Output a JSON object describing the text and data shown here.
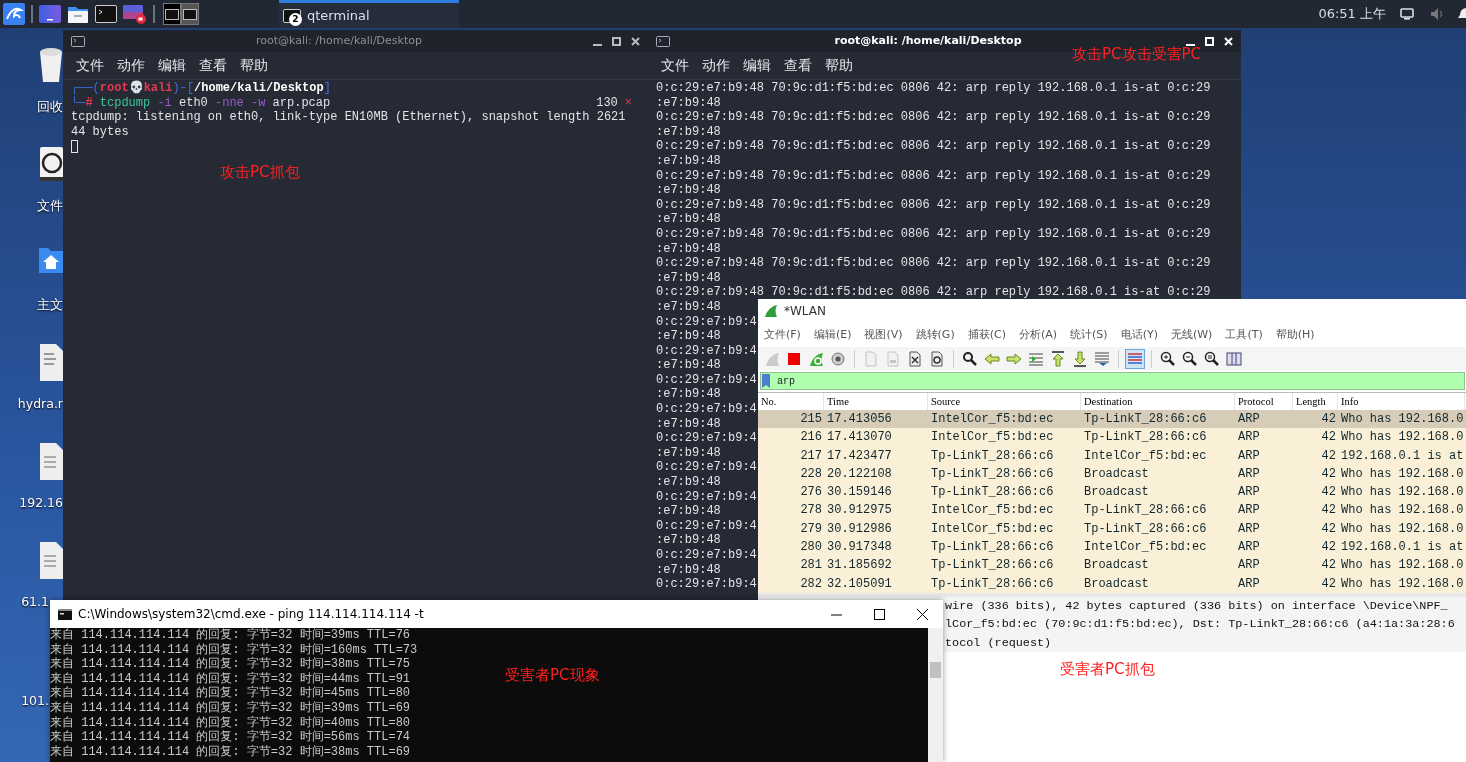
{
  "taskbar": {
    "workspaces": [
      {
        "selected": true
      },
      {
        "selected": false
      }
    ],
    "task": {
      "label": "qterminal",
      "badge": "2",
      "selected": true
    },
    "clock": "06:51 上午"
  },
  "desktop_icons": [
    {
      "label": "回收",
      "kind": "trash"
    },
    {
      "label": "文件",
      "kind": "drive"
    },
    {
      "label": "主文",
      "kind": "home"
    },
    {
      "label": "hydra.r",
      "kind": "binary"
    },
    {
      "label": "192.16",
      "kind": "locked"
    },
    {
      "label": "61.1",
      "kind": "locked"
    },
    {
      "label": "101.",
      "kind": "none"
    }
  ],
  "terminals": [
    {
      "title": "root@kali: /home/kali/Desktop",
      "active": false,
      "menu": [
        "文件",
        "动作",
        "编辑",
        "查看",
        "帮助"
      ],
      "prompt_lines": [
        [
          {
            "text": "┌──(",
            "kind": "frame"
          },
          {
            "text": "root",
            "kind": "user"
          },
          {
            "text": "💀",
            "kind": "symbol"
          },
          {
            "text": "kali",
            "kind": "user"
          },
          {
            "text": ")-[",
            "kind": "frame"
          },
          {
            "text": "/home/kali/Desktop",
            "kind": "path"
          },
          {
            "text": "]",
            "kind": "frame"
          }
        ],
        [
          {
            "text": "└─",
            "kind": "frame"
          },
          {
            "text": "#",
            "kind": "hash"
          },
          {
            "text": "tcpdump",
            "kind": "command"
          },
          {
            "text": "-i",
            "kind": "option"
          },
          {
            "text": "eth0",
            "kind": "argument"
          },
          {
            "text": "-nne",
            "kind": "option"
          },
          {
            "text": "-w",
            "kind": "option"
          },
          {
            "text": "arp.pcap",
            "kind": "argument"
          }
        ]
      ],
      "exit_status": {
        "code": "130",
        "mark": "×"
      },
      "lines": [
        "tcpdump: listening on eth0, link-type EN10MB (Ethernet), snapshot length 2621",
        "44 bytes"
      ],
      "cursor": true
    },
    {
      "title": "root@kali: /home/kali/Desktop",
      "active": true,
      "menu": [
        "文件",
        "动作",
        "编辑",
        "查看",
        "帮助"
      ],
      "lines": [
        "0:c:29:e7:b9:48 70:9c:d1:f5:bd:ec 0806 42: arp reply 192.168.0.1 is-at 0:c:29",
        ":e7:b9:48",
        "0:c:29:e7:b9:48 70:9c:d1:f5:bd:ec 0806 42: arp reply 192.168.0.1 is-at 0:c:29",
        ":e7:b9:48",
        "0:c:29:e7:b9:48 70:9c:d1:f5:bd:ec 0806 42: arp reply 192.168.0.1 is-at 0:c:29",
        ":e7:b9:48",
        "0:c:29:e7:b9:48 70:9c:d1:f5:bd:ec 0806 42: arp reply 192.168.0.1 is-at 0:c:29",
        ":e7:b9:48",
        "0:c:29:e7:b9:48 70:9c:d1:f5:bd:ec 0806 42: arp reply 192.168.0.1 is-at 0:c:29",
        ":e7:b9:48",
        "0:c:29:e7:b9:48 70:9c:d1:f5:bd:ec 0806 42: arp reply 192.168.0.1 is-at 0:c:29",
        ":e7:b9:48",
        "0:c:29:e7:b9:48 70:9c:d1:f5:bd:ec 0806 42: arp reply 192.168.0.1 is-at 0:c:29",
        ":e7:b9:48",
        "0:c:29:e7:b9:48 70:9c:d1:f5:bd:ec 0806 42: arp reply 192.168.0.1 is-at 0:c:29",
        ":e7:b9:48",
        "0:c:29:e7:b9:4",
        ":e7:b9:48",
        "0:c:29:e7:b9:4",
        ":e7:b9:48",
        "0:c:29:e7:b9:4",
        ":e7:b9:48",
        "0:c:29:e7:b9:4",
        ":e7:b9:48",
        "0:c:29:e7:b9:4",
        ":e7:b9:48",
        "0:c:29:e7:b9:4",
        ":e7:b9:48",
        "0:c:29:e7:b9:4",
        ":e7:b9:48",
        "0:c:29:e7:b9:4",
        ":e7:b9:48",
        "0:c:29:e7:b9:4",
        ":e7:b9:48",
        "0:c:29:e7:b9:4"
      ]
    }
  ],
  "wireshark": {
    "title": "*WLAN",
    "menu": [
      "文件(F)",
      "编辑(E)",
      "视图(V)",
      "跳转(G)",
      "捕获(C)",
      "分析(A)",
      "统计(S)",
      "电话(Y)",
      "无线(W)",
      "工具(T)",
      "帮助(H)"
    ],
    "toolbar": [
      [
        {
          "kind": "fin",
          "disabled": true,
          "pressed": false
        },
        {
          "kind": "stop",
          "disabled": false,
          "pressed": false
        },
        {
          "kind": "restart",
          "disabled": false,
          "pressed": false
        },
        {
          "kind": "options",
          "disabled": false,
          "pressed": false
        }
      ],
      [
        {
          "kind": "open",
          "disabled": true,
          "pressed": false
        },
        {
          "kind": "save",
          "disabled": true,
          "pressed": false
        },
        {
          "kind": "close",
          "disabled": false,
          "pressed": false
        },
        {
          "kind": "reload",
          "disabled": false,
          "pressed": false
        }
      ],
      [
        {
          "kind": "find",
          "disabled": false,
          "pressed": false
        },
        {
          "kind": "back",
          "disabled": false,
          "pressed": false
        },
        {
          "kind": "forward",
          "disabled": false,
          "pressed": false
        },
        {
          "kind": "goto",
          "disabled": false,
          "pressed": false
        },
        {
          "kind": "first",
          "disabled": false,
          "pressed": false
        },
        {
          "kind": "last",
          "disabled": false,
          "pressed": false
        },
        {
          "kind": "autoscroll",
          "disabled": false,
          "pressed": false
        }
      ],
      [
        {
          "kind": "colorize",
          "disabled": false,
          "pressed": true
        }
      ],
      [
        {
          "kind": "zoom-in",
          "disabled": false,
          "pressed": false
        },
        {
          "kind": "zoom-out",
          "disabled": false,
          "pressed": false
        },
        {
          "kind": "zoom-normal",
          "disabled": false,
          "pressed": false
        },
        {
          "kind": "resize",
          "disabled": false,
          "pressed": false
        }
      ]
    ],
    "filter": {
      "value": "arp"
    },
    "columns": [
      "No.",
      "Time",
      "Source",
      "Destination",
      "Protocol",
      "Length",
      "Info"
    ],
    "packets": [
      {
        "cells": [
          "215",
          "17.413056",
          "IntelCor_f5:bd:ec",
          "Tp-LinkT_28:66:c6",
          "ARP",
          "42",
          "Who has 192.168.0"
        ],
        "selected": true
      },
      {
        "cells": [
          "216",
          "17.413070",
          "IntelCor_f5:bd:ec",
          "Tp-LinkT_28:66:c6",
          "ARP",
          "42",
          "Who has 192.168.0"
        ],
        "selected": false
      },
      {
        "cells": [
          "217",
          "17.423477",
          "Tp-LinkT_28:66:c6",
          "IntelCor_f5:bd:ec",
          "ARP",
          "42",
          "192.168.0.1 is at"
        ],
        "selected": false
      },
      {
        "cells": [
          "228",
          "20.122108",
          "Tp-LinkT_28:66:c6",
          "Broadcast",
          "ARP",
          "42",
          "Who has 192.168.0"
        ],
        "selected": false
      },
      {
        "cells": [
          "276",
          "30.159146",
          "Tp-LinkT_28:66:c6",
          "Broadcast",
          "ARP",
          "42",
          "Who has 192.168.0"
        ],
        "selected": false
      },
      {
        "cells": [
          "278",
          "30.912975",
          "IntelCor_f5:bd:ec",
          "Tp-LinkT_28:66:c6",
          "ARP",
          "42",
          "Who has 192.168.0"
        ],
        "selected": false
      },
      {
        "cells": [
          "279",
          "30.912986",
          "IntelCor_f5:bd:ec",
          "Tp-LinkT_28:66:c6",
          "ARP",
          "42",
          "Who has 192.168.0"
        ],
        "selected": false
      },
      {
        "cells": [
          "280",
          "30.917348",
          "Tp-LinkT_28:66:c6",
          "IntelCor_f5:bd:ec",
          "ARP",
          "42",
          "192.168.0.1 is at"
        ],
        "selected": false
      },
      {
        "cells": [
          "281",
          "31.185692",
          "Tp-LinkT_28:66:c6",
          "Broadcast",
          "ARP",
          "42",
          "Who has 192.168.0"
        ],
        "selected": false
      },
      {
        "cells": [
          "282",
          "32.105091",
          "Tp-LinkT_28:66:c6",
          "Broadcast",
          "ARP",
          "42",
          "Who has 192.168.0"
        ],
        "selected": false
      }
    ],
    "details": [
      "wire (336 bits), 42 bytes captured (336 bits) on interface \\Device\\NPF_",
      "lCor_f5:bd:ec (70:9c:d1:f5:bd:ec), Dst: Tp-LinkT_28:66:c6 (a4:1a:3a:28:6",
      "tocol (request)"
    ]
  },
  "cmd": {
    "title": "C:\\Windows\\system32\\cmd.exe - ping  114.114.114.114 -t",
    "lines": [
      "来自 114.114.114.114 的回复: 字节=32 时间=39ms TTL=76",
      "来自 114.114.114.114 的回复: 字节=32 时间=160ms TTL=73",
      "来自 114.114.114.114 的回复: 字节=32 时间=38ms TTL=75",
      "来自 114.114.114.114 的回复: 字节=32 时间=44ms TTL=91",
      "来自 114.114.114.114 的回复: 字节=32 时间=45ms TTL=80",
      "来自 114.114.114.114 的回复: 字节=32 时间=39ms TTL=69",
      "来自 114.114.114.114 的回复: 字节=32 时间=40ms TTL=80",
      "来自 114.114.114.114 的回复: 字节=32 时间=56ms TTL=74",
      "来自 114.114.114.114 的回复: 字节=32 时间=38ms TTL=69"
    ]
  },
  "annotations": [
    {
      "text": "攻击PC攻击受害PC"
    },
    {
      "text": "攻击PC抓包"
    },
    {
      "text": "受害者PC现象"
    },
    {
      "text": "受害者PC抓包"
    }
  ]
}
